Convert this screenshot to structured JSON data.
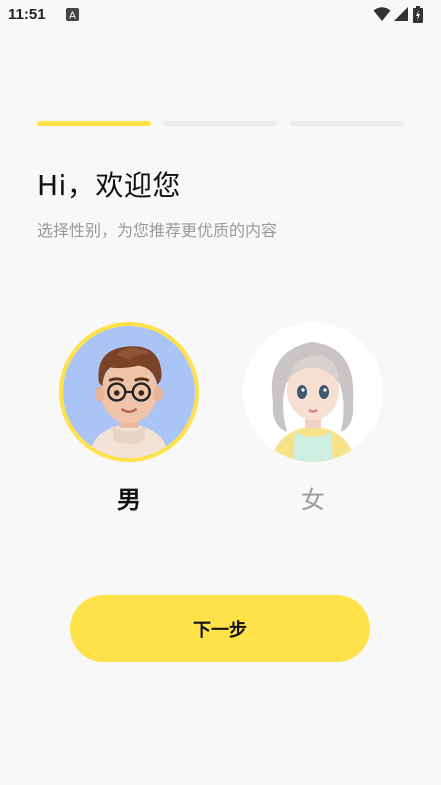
{
  "status_bar": {
    "time": "11:51",
    "icons": [
      "notification-a-icon",
      "wifi-icon",
      "cellular-signal-icon",
      "battery-icon"
    ]
  },
  "progress": {
    "current_step": 1,
    "total_steps": 3,
    "active_color": "#ffe24a",
    "inactive_color": "#ececec"
  },
  "header": {
    "title": "Hi，欢迎您",
    "subtitle": "选择性别，为您推荐更优质的内容"
  },
  "genders": [
    {
      "label": "男",
      "selected": true,
      "avatar": "male-avatar"
    },
    {
      "label": "女",
      "selected": false,
      "avatar": "female-avatar"
    }
  ],
  "next_button": {
    "label": "下一步",
    "color": "#ffe24a"
  }
}
